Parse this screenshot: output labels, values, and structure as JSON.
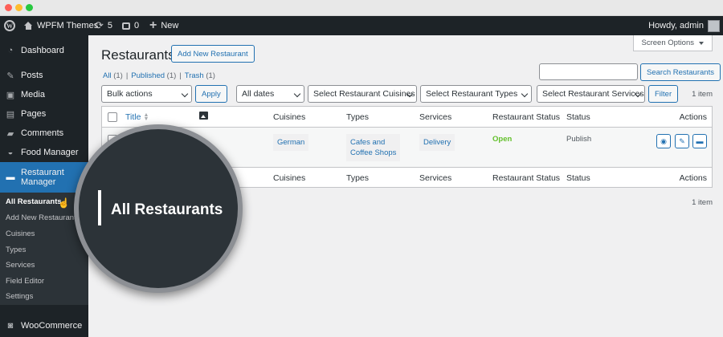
{
  "adminbar": {
    "site_name": "WPFM Themes",
    "updates_count": "5",
    "comments_count": "0",
    "new_label": "New",
    "howdy": "Howdy, admin"
  },
  "sidebar": {
    "items": [
      {
        "label": "Dashboard",
        "icon": "dashboard-icon"
      },
      {
        "label": "Posts",
        "icon": "pin-icon"
      },
      {
        "label": "Media",
        "icon": "media-icon"
      },
      {
        "label": "Pages",
        "icon": "pages-icon"
      },
      {
        "label": "Comments",
        "icon": "comments-icon"
      },
      {
        "label": "Food Manager",
        "icon": "food-manager-icon"
      },
      {
        "label": "Restaurant Manager",
        "icon": "restaurant-manager-icon"
      },
      {
        "label": "WooCommerce",
        "icon": "woocommerce-icon"
      }
    ],
    "submenu": [
      "All Restaurants",
      "Add New Restaurant",
      "Cuisines",
      "Types",
      "Services",
      "Field Editor",
      "Settings"
    ]
  },
  "screen_options": "Screen Options",
  "page": {
    "title": "Restaurants",
    "add_new": "Add New Restaurant",
    "views": {
      "all": "All",
      "all_count": "(1)",
      "published": "Published",
      "published_count": "(1)",
      "trash": "Trash",
      "trash_count": "(1)",
      "sep": "|"
    },
    "search_button": "Search Restaurants",
    "search_placeholder": ""
  },
  "filters": {
    "bulk_actions": "Bulk actions",
    "apply": "Apply",
    "dates": "All dates",
    "cuisines": "Select Restaurant Cuisines",
    "types": "Select Restaurant Types",
    "services": "Select Restaurant Services",
    "filter": "Filter",
    "count": "1 item"
  },
  "table": {
    "columns": [
      "Title",
      "Cuisines",
      "Types",
      "Services",
      "Restaurant Status",
      "Status",
      "Actions"
    ],
    "row": {
      "cuisine": "German",
      "type_line1": "Cafes and",
      "type_line2": "Coffee Shops",
      "service": "Delivery",
      "restaurant_status": "Open",
      "status": "Publish"
    }
  },
  "magnifier_label": "All Restaurants",
  "colors": {
    "accent": "#2271b1",
    "sidebar_bg": "#1d2327",
    "open_green": "#63c02b"
  }
}
